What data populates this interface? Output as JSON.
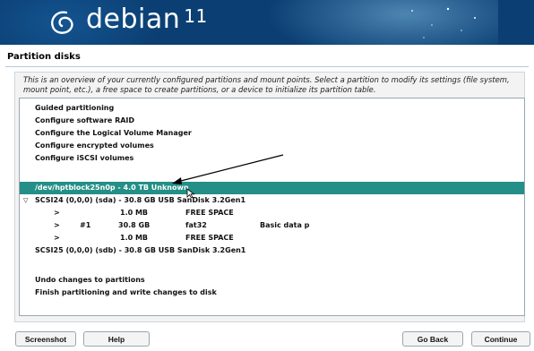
{
  "banner": {
    "brand": "debian",
    "version": "11"
  },
  "page": {
    "title": "Partition disks"
  },
  "description": "This is an overview of your currently configured partitions and mount points. Select a partition to modify its settings (file system, mount point, etc.), a free space to create partitions, or a device to initialize its partition table.",
  "items": [
    {
      "col1": "Guided partitioning"
    },
    {
      "col1": "Configure software RAID"
    },
    {
      "col1": "Configure the Logical Volume Manager"
    },
    {
      "col1": "Configure encrypted volumes"
    },
    {
      "col1": "Configure iSCSI volumes"
    },
    {
      "col1": ""
    },
    {
      "col1": "/dev/hptblock25n0p - 4.0 TB Unknown"
    },
    {
      "toggle": "▽",
      "col1": "SCSI24 (0,0,0) (sda) - 30.8 GB  USB  SanDisk 3.2Gen1"
    },
    {
      "arrow": ">",
      "num": "",
      "size": "1.0 MB",
      "type": "FREE SPACE",
      "name": ""
    },
    {
      "arrow": ">",
      "num": "#1",
      "size": "30.8 GB",
      "type": "fat32",
      "name": "Basic data p"
    },
    {
      "arrow": ">",
      "num": "",
      "size": "1.0 MB",
      "type": "FREE SPACE",
      "name": ""
    },
    {
      "col1": "SCSI25 (0,0,0) (sdb) - 30.8 GB  USB  SanDisk 3.2Gen1"
    },
    {
      "col1": ""
    },
    {
      "col1": "Undo changes to partitions"
    },
    {
      "col1": "Finish partitioning and write changes to disk"
    }
  ],
  "buttons": {
    "screenshot": "Screenshot",
    "help": "Help",
    "go_back": "Go Back",
    "continue": "Continue"
  },
  "colors": {
    "banner": "#0b3f73",
    "selection": "#238f86"
  }
}
